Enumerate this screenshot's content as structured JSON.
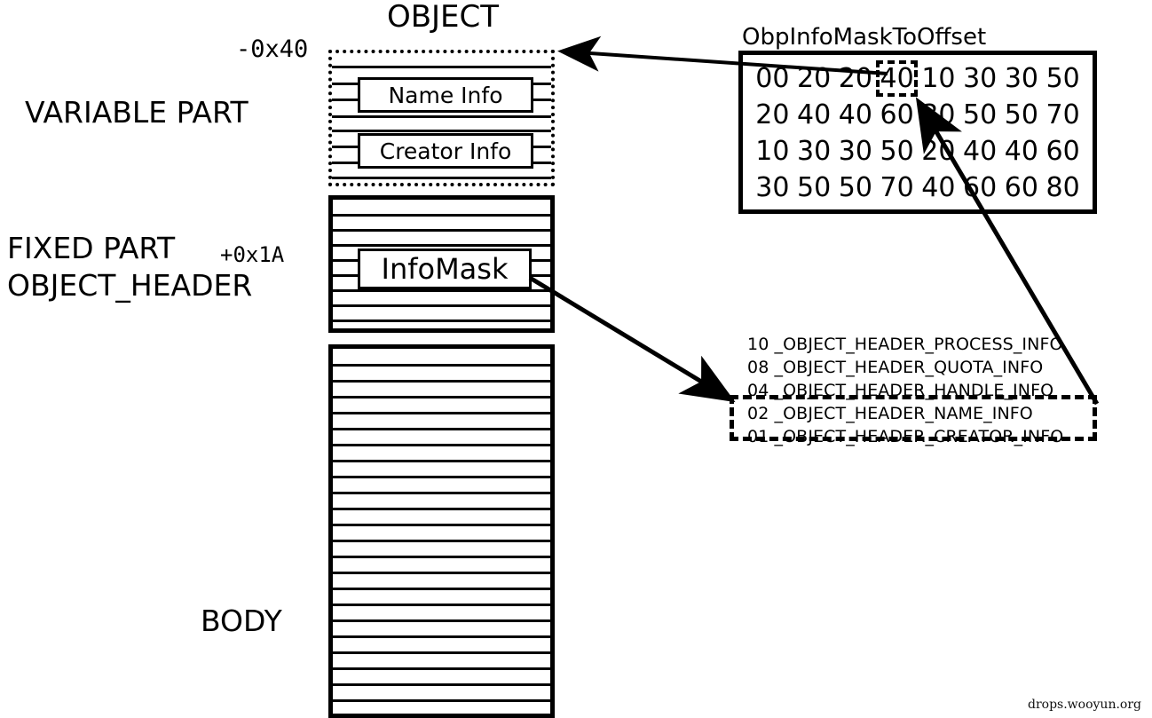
{
  "diagram": {
    "title": "OBJECT",
    "watermark": "drops.wooyun.org"
  },
  "labels": {
    "offset_top": "-0x40",
    "variable_part": "VARIABLE PART",
    "fixed_part": "FIXED PART",
    "fixed_part_offset": "+0x1A",
    "object_header": "OBJECT_HEADER",
    "body": "BODY"
  },
  "variable_part": {
    "boxes": [
      {
        "label": "Name Info"
      },
      {
        "label": "Creator Info"
      }
    ]
  },
  "fixed_part": {
    "boxes": [
      {
        "label": "InfoMask"
      }
    ]
  },
  "mask_table": {
    "title": "ObpInfoMaskToOffset",
    "highlight": {
      "row": 0,
      "col": 3,
      "value": "40"
    },
    "rows": [
      [
        "00",
        "20",
        "20",
        "40",
        "10",
        "30",
        "30",
        "50"
      ],
      [
        "20",
        "40",
        "40",
        "60",
        "30",
        "50",
        "50",
        "70"
      ],
      [
        "10",
        "30",
        "30",
        "50",
        "20",
        "40",
        "40",
        "60"
      ],
      [
        "30",
        "50",
        "50",
        "70",
        "40",
        "60",
        "60",
        "80"
      ]
    ]
  },
  "legend": {
    "entries": [
      {
        "code": "10",
        "name": "_OBJECT_HEADER_PROCESS_INFO",
        "boxed": false
      },
      {
        "code": "08",
        "name": "_OBJECT_HEADER_QUOTA_INFO",
        "boxed": false
      },
      {
        "code": "04",
        "name": "_OBJECT_HEADER_HANDLE_INFO",
        "boxed": false
      },
      {
        "code": "02",
        "name": "_OBJECT_HEADER_NAME_INFO",
        "boxed": true
      },
      {
        "code": "01",
        "name": "_OBJECT_HEADER_CREATOR_INFO",
        "boxed": true
      }
    ]
  },
  "arrows": [
    {
      "name": "table-to-object-top",
      "from": "mask-table-highlight",
      "to": "variable-part-top-right"
    },
    {
      "name": "infomask-to-legend",
      "from": "infomask-box",
      "to": "legend-dashed-box"
    },
    {
      "name": "legend-to-table-cell",
      "from": "legend-dashed-box",
      "to": "mask-table-highlight"
    }
  ],
  "colors": {
    "stroke": "#000000",
    "background": "#ffffff"
  }
}
